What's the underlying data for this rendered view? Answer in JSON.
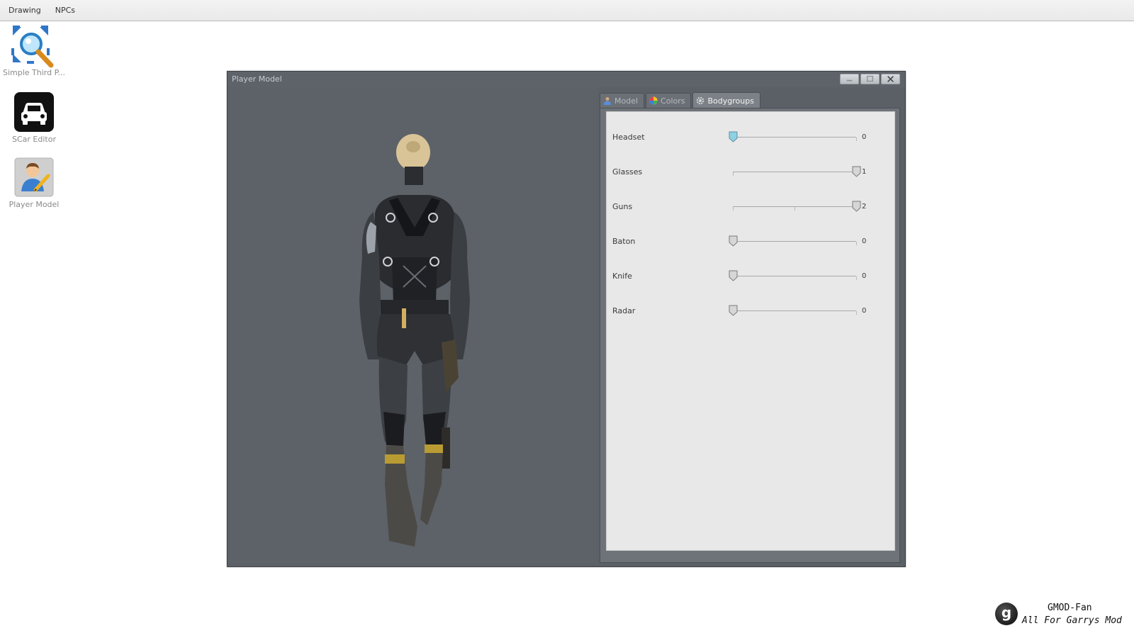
{
  "menubar": {
    "items": [
      "Drawing",
      "NPCs"
    ]
  },
  "desktop": {
    "icons": [
      {
        "label": "Simple Third P...",
        "icon": "magnifier-expand-icon"
      },
      {
        "label": "SCar Editor",
        "icon": "car-icon"
      },
      {
        "label": "Player Model",
        "icon": "player-edit-icon"
      }
    ]
  },
  "window": {
    "title": "Player Model",
    "controls": [
      "minimize-icon",
      "maximize-icon",
      "close-icon"
    ],
    "preview": {
      "content": "player-model-3d-preview"
    },
    "tabs": [
      {
        "label": "Model",
        "icon": "person-icon",
        "active": false
      },
      {
        "label": "Colors",
        "icon": "color-wheel-icon",
        "active": false
      },
      {
        "label": "Bodygroups",
        "icon": "gear-icon",
        "active": true
      }
    ],
    "bodygroups": [
      {
        "label": "Headset",
        "value": 0,
        "max": 1,
        "highlighted": true
      },
      {
        "label": "Glasses",
        "value": 1,
        "max": 1,
        "highlighted": false
      },
      {
        "label": "Guns",
        "value": 2,
        "max": 2,
        "highlighted": false
      },
      {
        "label": "Baton",
        "value": 0,
        "max": 1,
        "highlighted": false
      },
      {
        "label": "Knife",
        "value": 0,
        "max": 1,
        "highlighted": false
      },
      {
        "label": "Radar",
        "value": 0,
        "max": 1,
        "highlighted": false
      }
    ]
  },
  "watermark": {
    "logo_letter": "g",
    "line1": "GMOD-Fan",
    "line2": "All For Garrys Mod"
  },
  "colors": {
    "window_bg": "#5b6066",
    "panel_bg": "#e8e8e8",
    "thumb_highlight": "#8fd0e3",
    "thumb_normal": "#d6d6d6"
  }
}
